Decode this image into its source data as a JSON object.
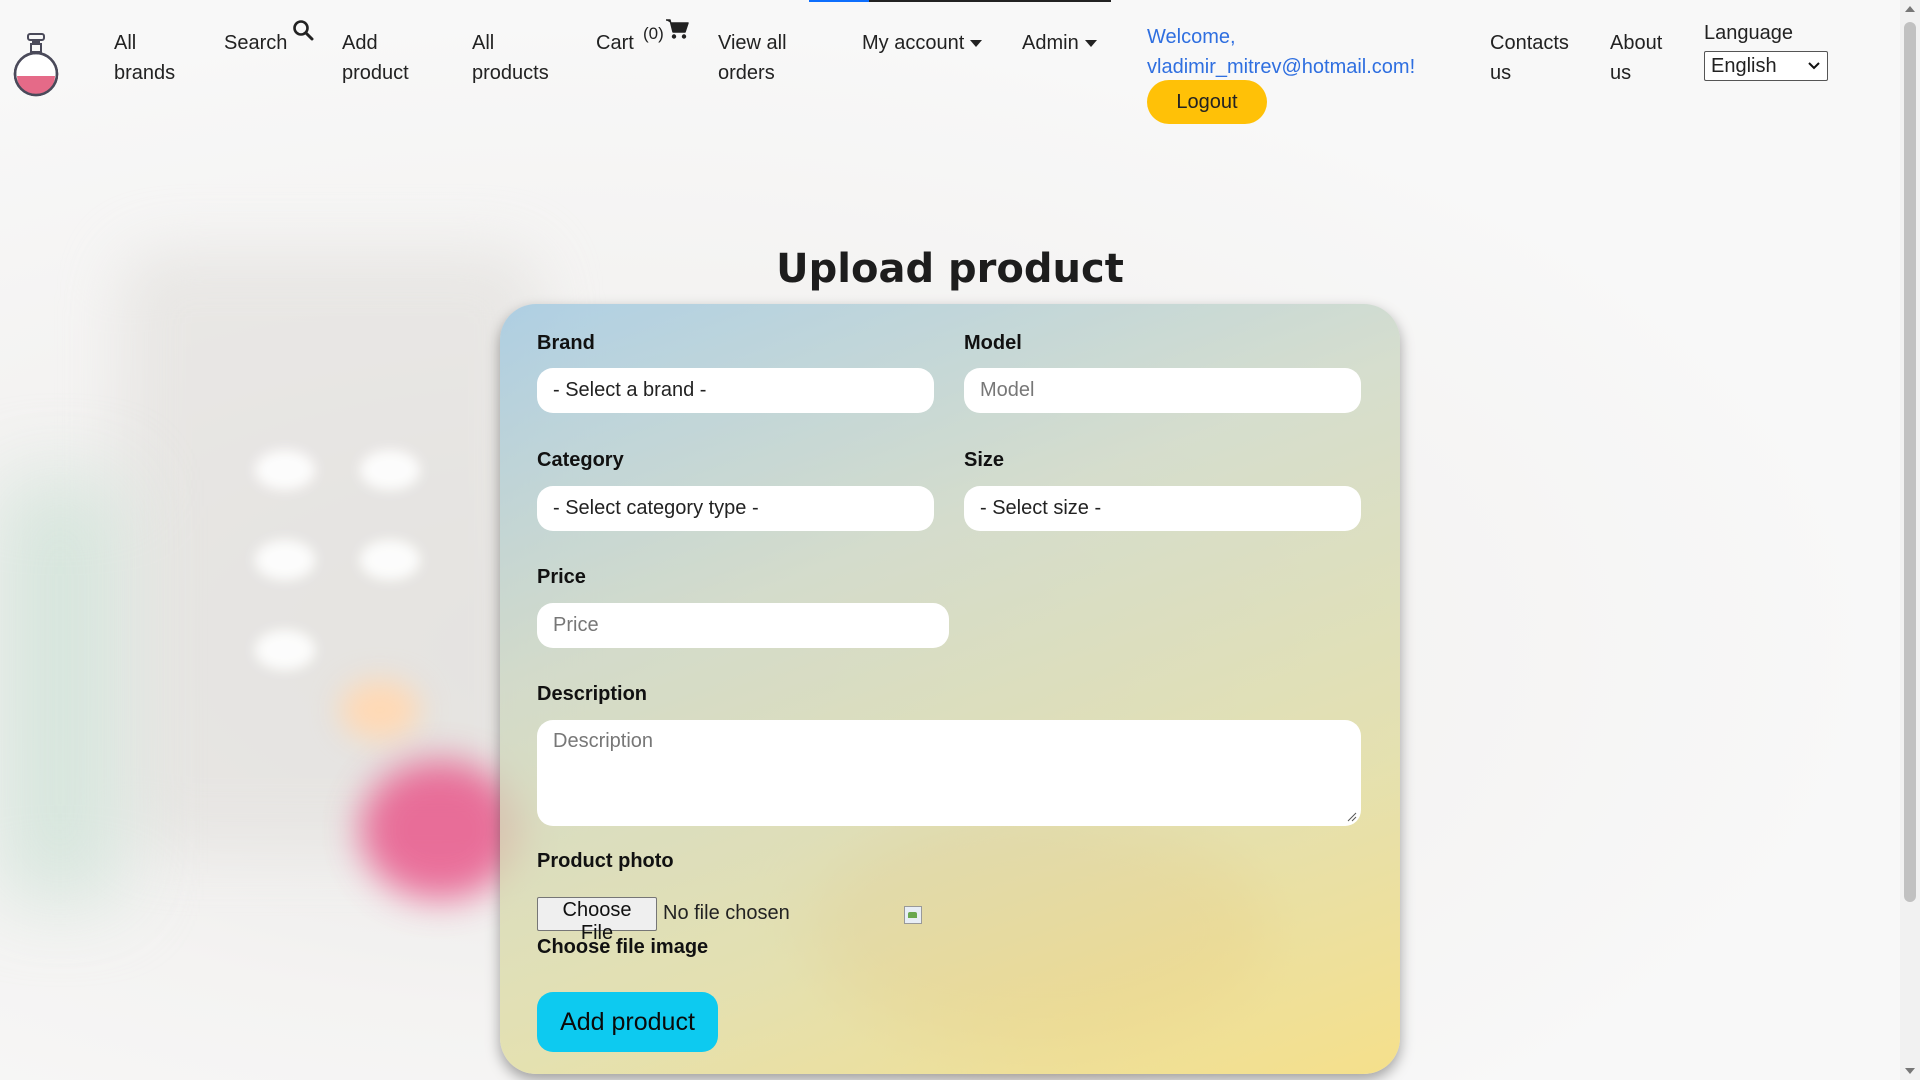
{
  "nav": {
    "all_brands": "All brands",
    "search": "Search",
    "add_product": "Add product",
    "all_products": "All products",
    "cart": "Cart",
    "cart_count": "(0)",
    "view_all_orders": "View all orders",
    "my_account": "My account",
    "admin": "Admin",
    "welcome": "Welcome, vladimir_mitrev@hotmail.com!",
    "logout": "Logout",
    "contacts": "Contacts us",
    "about": "About us",
    "language_label": "Language",
    "language_value": "English"
  },
  "page": {
    "title": "Upload product"
  },
  "form": {
    "brand_label": "Brand",
    "brand_value": "- Select a brand -",
    "model_label": "Model",
    "model_placeholder": "Model",
    "category_label": "Category",
    "category_value": "- Select category type -",
    "size_label": "Size",
    "size_value": "- Select size -",
    "price_label": "Price",
    "price_placeholder": "Price",
    "description_label": "Description",
    "description_placeholder": "Description",
    "photo_label": "Product photo",
    "file_button": "Choose File",
    "file_status": "No file chosen",
    "choose_file_note": "Choose file image",
    "submit": "Add product"
  },
  "colors": {
    "logout_bg": "#ffc107",
    "submit_bg": "#0dcaf0",
    "welcome_text": "#2f6fe0"
  },
  "icons": {
    "logo": "perfume-bottle-icon",
    "search": "search-icon",
    "cart": "cart-icon"
  }
}
